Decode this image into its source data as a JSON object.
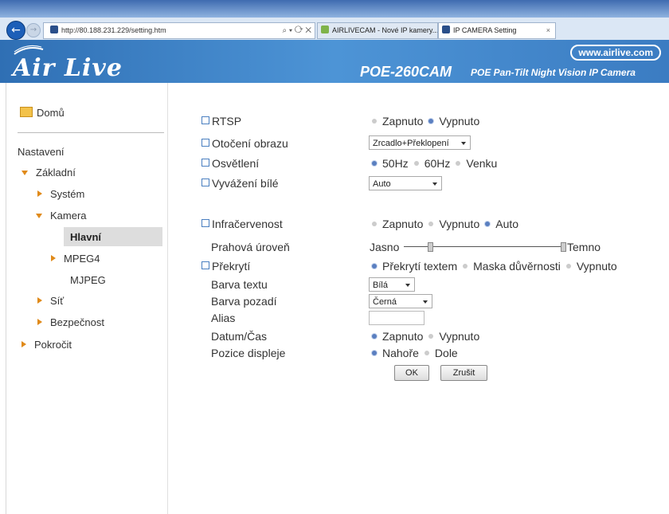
{
  "browser": {
    "url": "http://80.188.231.229/setting.htm",
    "addr_controls": "⌕ ▾ ⟳ ✕",
    "tabs": [
      {
        "title": "AIRLIVECAM - Nové IP kamery..."
      },
      {
        "title": "IP CAMERA Setting"
      }
    ],
    "tab_close": "×"
  },
  "banner": {
    "logo": "Air Live",
    "website": "www.airlive.com",
    "model": "POE-260CAM",
    "tagline": "POE Pan-Tilt Night Vision IP Camera"
  },
  "sidebar": {
    "home": "Domů",
    "settings_heading": "Nastavení",
    "items": [
      {
        "label": "Základní"
      },
      {
        "label": "Systém"
      },
      {
        "label": "Kamera"
      },
      {
        "label": "Hlavní"
      },
      {
        "label": "MPEG4"
      },
      {
        "label": "MJPEG"
      },
      {
        "label": "Síť"
      },
      {
        "label": "Bezpečnost"
      },
      {
        "label": "Pokročit"
      }
    ]
  },
  "form": {
    "rtsp": {
      "label": "RTSP",
      "options": [
        "Zapnuto",
        "Vypnuto"
      ],
      "selected": "Vypnuto"
    },
    "rotation": {
      "label": "Otočení obrazu",
      "value": "Zrcadlo+Překlopení"
    },
    "lighting": {
      "label": "Osvětlení",
      "options": [
        "50Hz",
        "60Hz",
        "Venku"
      ],
      "selected": "50Hz"
    },
    "white_balance": {
      "label": "Vyvážení bílé",
      "value": "Auto"
    },
    "infrared": {
      "label": "Infračervenost",
      "options": [
        "Zapnuto",
        "Vypnuto",
        "Auto"
      ],
      "selected": "Auto"
    },
    "threshold": {
      "label": "Prahová úroveň",
      "left": "Jasno",
      "right": "Temno",
      "level": 0.15
    },
    "overlay": {
      "label": "Překrytí",
      "options": [
        "Překrytí textem",
        "Maska důvěrnosti",
        "Vypnuto"
      ],
      "selected": "Překrytí textem"
    },
    "text_color": {
      "label": "Barva textu",
      "value": "Bílá"
    },
    "bg_color": {
      "label": "Barva pozadí",
      "value": "Černá"
    },
    "alias": {
      "label": "Alias",
      "value": ""
    },
    "datetime": {
      "label": "Datum/Čas",
      "options": [
        "Zapnuto",
        "Vypnuto"
      ],
      "selected": "Zapnuto"
    },
    "position": {
      "label": "Pozice displeje",
      "options": [
        "Nahoře",
        "Dole"
      ],
      "selected": "Nahoře"
    },
    "ok": "OK",
    "cancel": "Zrušit"
  }
}
